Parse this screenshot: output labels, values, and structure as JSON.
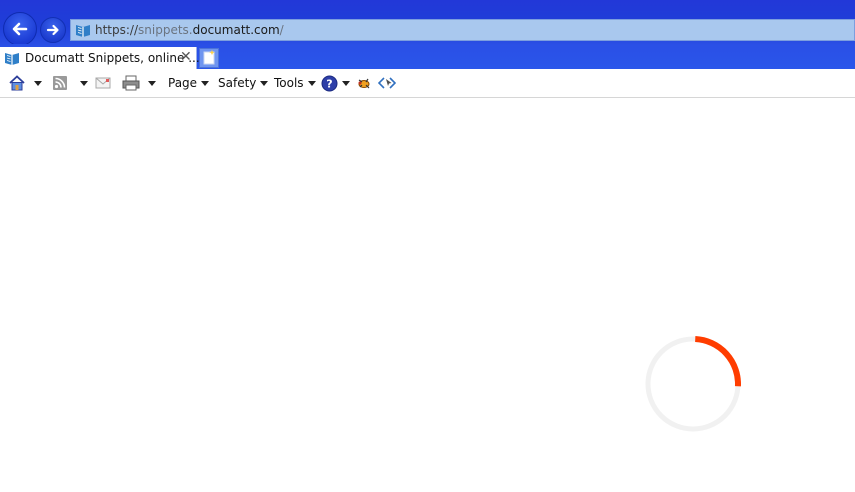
{
  "browser": {
    "address": {
      "scheme": "https://",
      "subdomain": "snippets.",
      "domain": "documatt.com",
      "path": "/"
    },
    "tab": {
      "title": "Documatt Snippets, online ...",
      "close_glyph": "✕"
    }
  },
  "commandbar": {
    "page_label": "Page",
    "safety_label": "Safety",
    "tools_label": "Tools"
  },
  "icons": {
    "back": "back-arrow-icon",
    "forward": "forward-arrow-icon",
    "site": "documatt-site-icon",
    "home": "home-icon",
    "feeds": "rss-feed-icon",
    "mail": "mail-icon",
    "print": "printer-icon",
    "help": "help-icon",
    "extension1": "bug-extension-icon",
    "extension2": "dev-tools-icon"
  },
  "colors": {
    "chrome_blue": "#1f3ed8",
    "address_bg": "#a9c8ee",
    "spinner_accent": "#ff3d00",
    "spinner_track": "#f1f1f1"
  },
  "loading": {
    "progress_fraction": 0.25
  }
}
